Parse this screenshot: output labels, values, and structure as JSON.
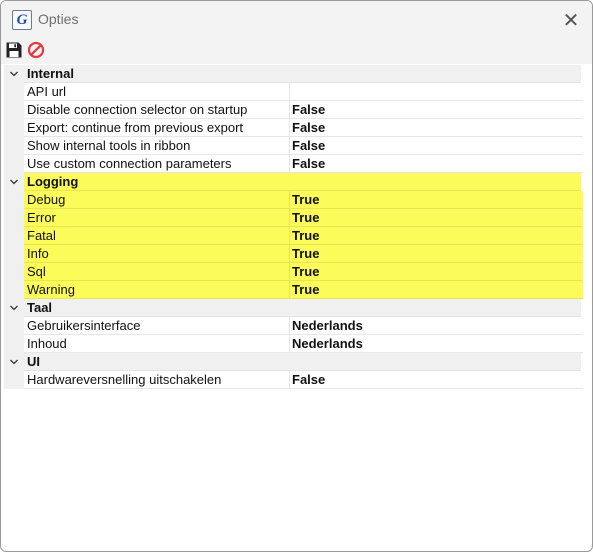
{
  "window": {
    "title": "Opties",
    "app_icon_letter": "G",
    "close_glyph": "✕"
  },
  "toolbar": {
    "save_icon": "save-icon",
    "cancel_icon": "cancel-icon"
  },
  "colors": {
    "highlight": "#fbfb59",
    "category_bg": "#f0f0f0",
    "cancel_red": "#e0393e"
  },
  "categories": [
    {
      "label": "Internal",
      "highlighted": false,
      "properties": [
        {
          "name": "API url",
          "value": ""
        },
        {
          "name": "Disable connection selector on startup",
          "value": "False"
        },
        {
          "name": "Export: continue from previous export",
          "value": "False"
        },
        {
          "name": "Show internal tools in ribbon",
          "value": "False"
        },
        {
          "name": "Use custom connection parameters",
          "value": "False"
        }
      ]
    },
    {
      "label": "Logging",
      "highlighted": true,
      "properties": [
        {
          "name": "Debug",
          "value": "True"
        },
        {
          "name": "Error",
          "value": "True"
        },
        {
          "name": "Fatal",
          "value": "True"
        },
        {
          "name": "Info",
          "value": "True"
        },
        {
          "name": "Sql",
          "value": "True"
        },
        {
          "name": "Warning",
          "value": "True"
        }
      ]
    },
    {
      "label": "Taal",
      "highlighted": false,
      "properties": [
        {
          "name": "Gebruikersinterface",
          "value": "Nederlands"
        },
        {
          "name": "Inhoud",
          "value": "Nederlands"
        }
      ]
    },
    {
      "label": "UI",
      "highlighted": false,
      "properties": [
        {
          "name": "Hardwareversnelling uitschakelen",
          "value": "False"
        }
      ]
    }
  ]
}
